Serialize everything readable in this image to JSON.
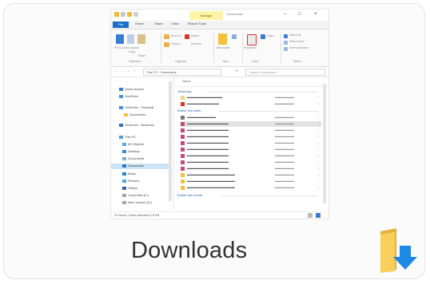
{
  "card": {
    "title": "Downloads",
    "icon": "downloads-folder-icon"
  },
  "explorer": {
    "window_title": "Downloads",
    "contextual_tab": "Manage",
    "tabs": [
      "File",
      "Home",
      "Share",
      "View",
      "Picture Tools"
    ],
    "ribbon_groups": [
      "Clipboard",
      "Organize",
      "New",
      "Open",
      "Select"
    ],
    "ribbon_items": [
      "Pin to Quick access",
      "Copy",
      "Paste",
      "Move to",
      "Copy to",
      "Delete",
      "Rename",
      "New folder",
      "Properties",
      "Open",
      "Select all",
      "Select none",
      "Invert selection"
    ],
    "address": "This PC › Downloads",
    "search_placeholder": "Search Downloads",
    "column_header": "Name",
    "nav_items": [
      "Quick access",
      "OneDrive",
      "OneDrive - Personal",
      "Documents",
      "OneDrive - Business",
      "This PC",
      "3D Objects",
      "Desktop",
      "Documents",
      "Downloads",
      "Music",
      "Pictures",
      "Videos",
      "Local Disk (C:)",
      "New Volume (D:)"
    ],
    "groups": [
      "Yesterday",
      "Earlier this week",
      "Earlier this month"
    ],
    "status": "20 items   1 item selected 3.5 KB"
  },
  "colors": {
    "accent": "#1a6fc9",
    "folder": "#f5c13a",
    "arrow": "#1e88e5",
    "manage": "#fff3a8"
  }
}
